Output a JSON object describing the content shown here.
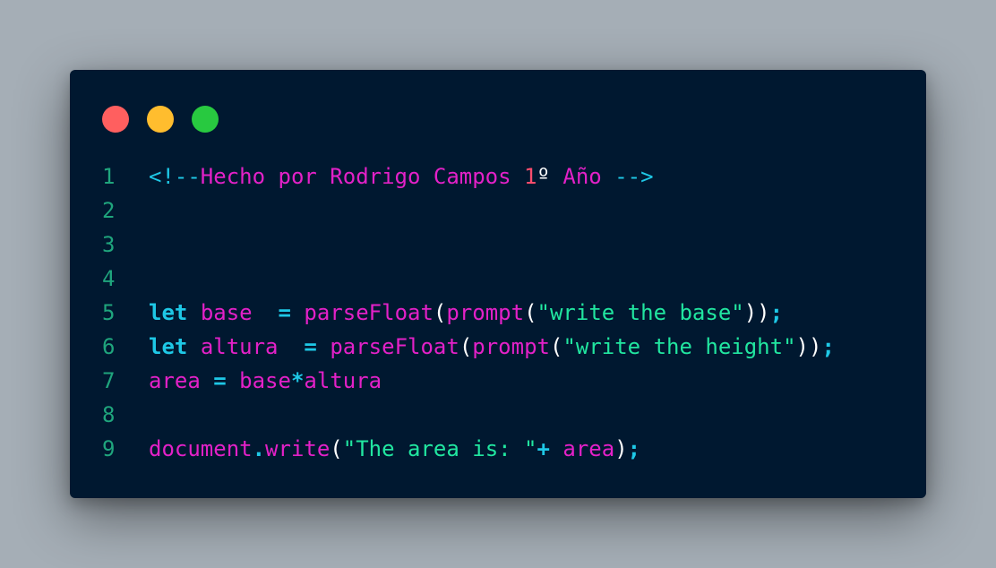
{
  "window": {
    "controls": [
      {
        "name": "close",
        "color": "#ff5f5f"
      },
      {
        "name": "minimize",
        "color": "#ffbd2e"
      },
      {
        "name": "maximize",
        "color": "#28c940"
      }
    ]
  },
  "editor": {
    "lines": [
      {
        "number": "1",
        "tokens": [
          {
            "text": "<!--",
            "type": "cm"
          },
          {
            "text": "Hecho por Rodrigo Campos ",
            "type": "cmtext"
          },
          {
            "text": "1",
            "type": "num"
          },
          {
            "text": "º",
            "type": "punc"
          },
          {
            "text": " Año ",
            "type": "cmtext"
          },
          {
            "text": "-->",
            "type": "cm"
          }
        ]
      },
      {
        "number": "2",
        "tokens": []
      },
      {
        "number": "3",
        "tokens": []
      },
      {
        "number": "4",
        "tokens": []
      },
      {
        "number": "5",
        "tokens": [
          {
            "text": "let",
            "type": "kw"
          },
          {
            "text": " ",
            "type": "punc"
          },
          {
            "text": "base",
            "type": "id"
          },
          {
            "text": "  ",
            "type": "punc"
          },
          {
            "text": "=",
            "type": "op"
          },
          {
            "text": " ",
            "type": "punc"
          },
          {
            "text": "parseFloat",
            "type": "id"
          },
          {
            "text": "(",
            "type": "punc"
          },
          {
            "text": "prompt",
            "type": "id"
          },
          {
            "text": "(",
            "type": "punc"
          },
          {
            "text": "\"write the base\"",
            "type": "str"
          },
          {
            "text": "))",
            "type": "punc"
          },
          {
            "text": ";",
            "type": "op"
          }
        ]
      },
      {
        "number": "6",
        "tokens": [
          {
            "text": "let",
            "type": "kw"
          },
          {
            "text": " ",
            "type": "punc"
          },
          {
            "text": "altura",
            "type": "id"
          },
          {
            "text": "  ",
            "type": "punc"
          },
          {
            "text": "=",
            "type": "op"
          },
          {
            "text": " ",
            "type": "punc"
          },
          {
            "text": "parseFloat",
            "type": "id"
          },
          {
            "text": "(",
            "type": "punc"
          },
          {
            "text": "prompt",
            "type": "id"
          },
          {
            "text": "(",
            "type": "punc"
          },
          {
            "text": "\"write the height\"",
            "type": "str"
          },
          {
            "text": "))",
            "type": "punc"
          },
          {
            "text": ";",
            "type": "op"
          }
        ]
      },
      {
        "number": "7",
        "tokens": [
          {
            "text": "area",
            "type": "id"
          },
          {
            "text": " ",
            "type": "punc"
          },
          {
            "text": "=",
            "type": "op"
          },
          {
            "text": " ",
            "type": "punc"
          },
          {
            "text": "base",
            "type": "id"
          },
          {
            "text": "*",
            "type": "op"
          },
          {
            "text": "altura",
            "type": "id"
          }
        ]
      },
      {
        "number": "8",
        "tokens": []
      },
      {
        "number": "9",
        "tokens": [
          {
            "text": "document",
            "type": "id"
          },
          {
            "text": ".",
            "type": "op"
          },
          {
            "text": "write",
            "type": "id"
          },
          {
            "text": "(",
            "type": "punc"
          },
          {
            "text": "\"The area is: \"",
            "type": "str"
          },
          {
            "text": "+",
            "type": "op"
          },
          {
            "text": " ",
            "type": "punc"
          },
          {
            "text": "area",
            "type": "id"
          },
          {
            "text": ")",
            "type": "punc"
          },
          {
            "text": ";",
            "type": "op"
          }
        ]
      }
    ]
  }
}
